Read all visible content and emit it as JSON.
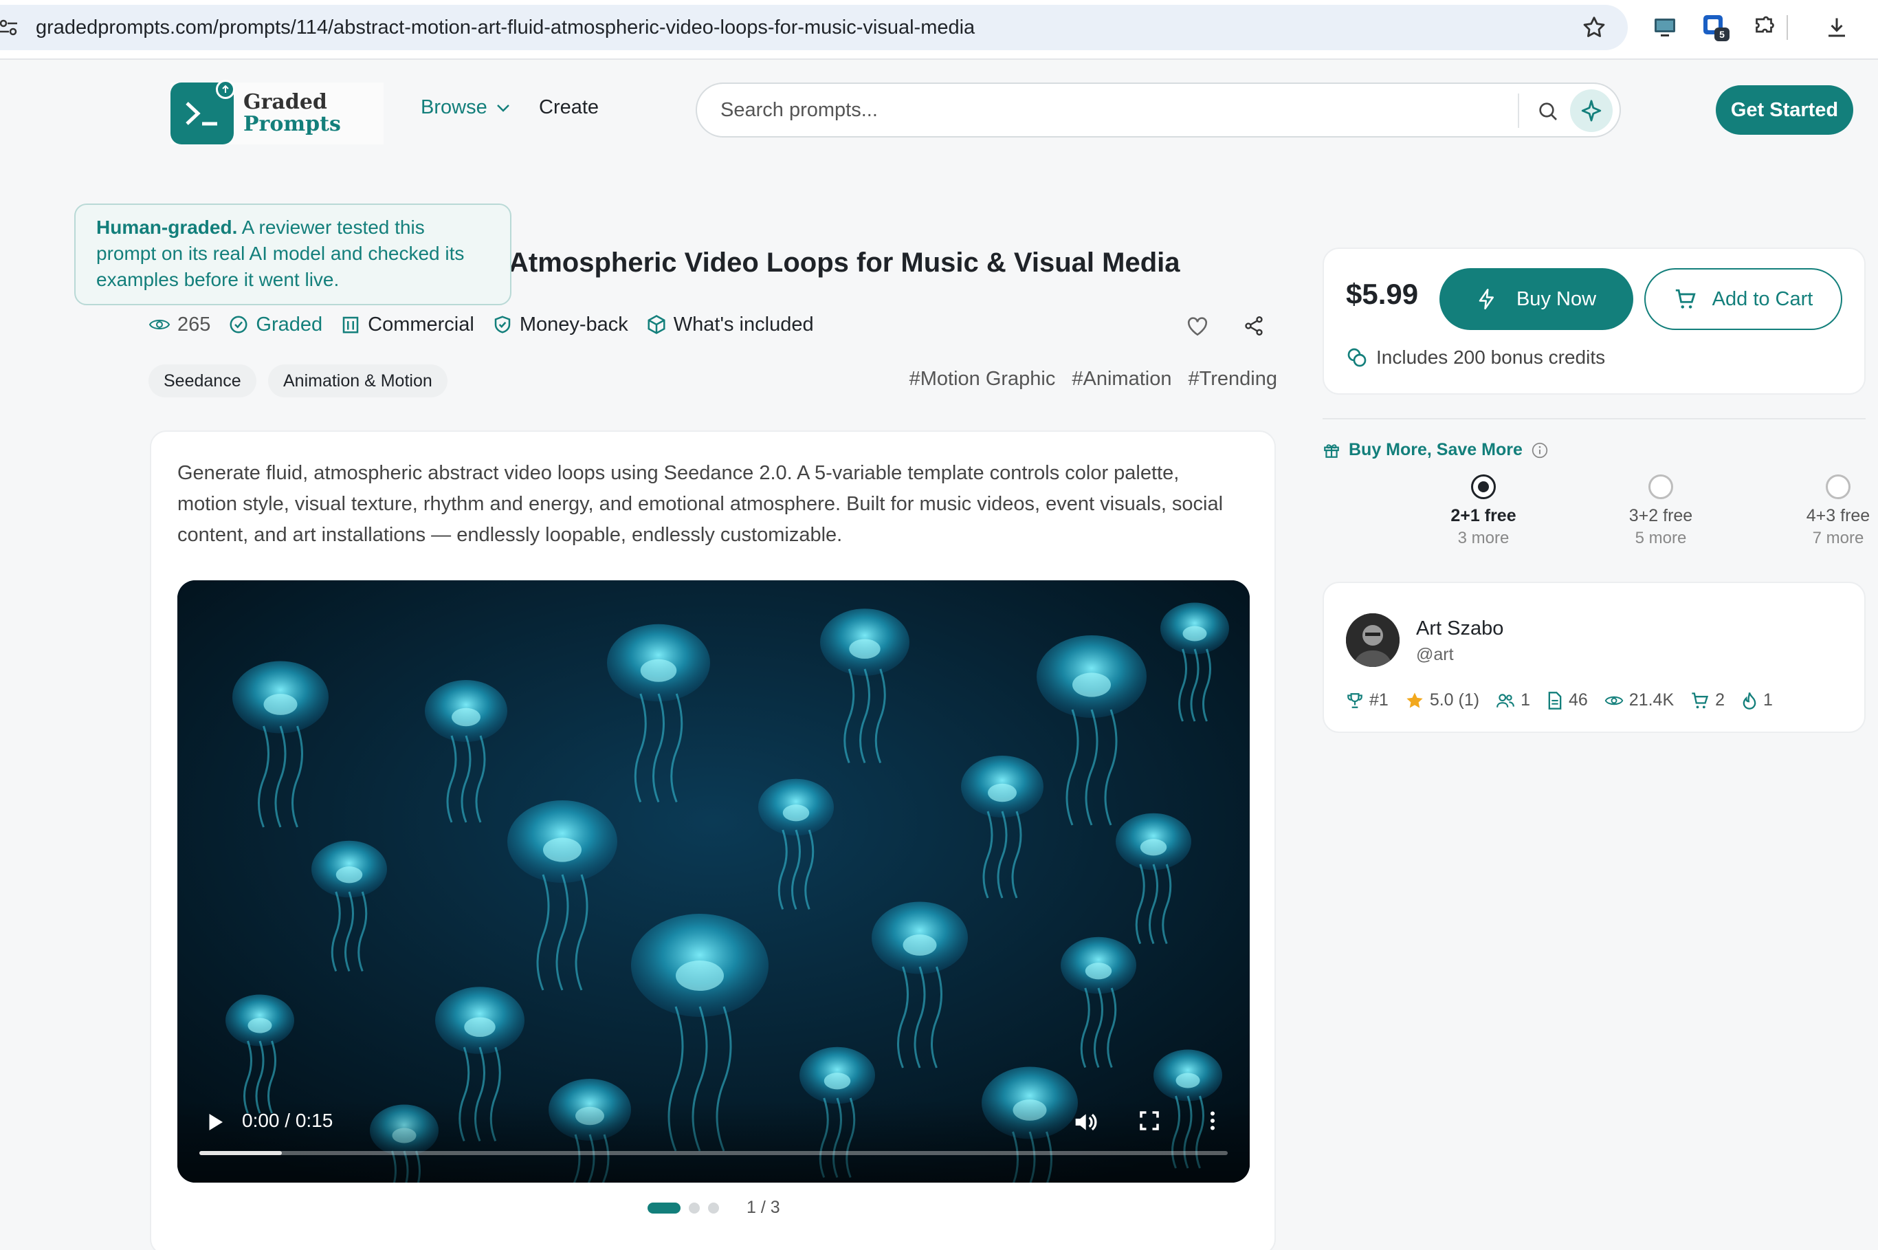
{
  "browser": {
    "url": "gradedprompts.com/prompts/114/abstract-motion-art-fluid-atmospheric-video-loops-for-music-visual-media",
    "extension_badge": "5"
  },
  "header": {
    "logo_line1": "Graded",
    "logo_line2": "Prompts",
    "nav_browse": "Browse",
    "nav_create": "Create",
    "search_placeholder": "Search prompts...",
    "get_started": "Get Started"
  },
  "prompt": {
    "title_visible": "Atmospheric Video Loops for Music & Visual Media",
    "tooltip_bold": "Human-graded.",
    "tooltip_text": " A reviewer tested this prompt on its real AI model and checked its examples before it went live.",
    "views": "265",
    "badge_graded": "Graded",
    "badge_commercial": "Commercial",
    "badge_moneyback": "Money-back",
    "badge_included": "What's included",
    "chips": [
      "Seedance",
      "Animation & Motion"
    ],
    "hashtags": [
      "#Motion Graphic",
      "#Animation",
      "#Trending"
    ],
    "description": "Generate fluid, atmospheric abstract video loops using Seedance 2.0. A 5-variable template controls color palette, motion style, visual texture, rhythm and energy, and emotional atmosphere. Built for music videos, event visuals, social content, and art installations — endlessly loopable, endlessly customizable."
  },
  "video": {
    "time": "0:00 / 0:15",
    "progress": 0.08,
    "pager": "1 / 3"
  },
  "purchase": {
    "price": "$5.99",
    "buy_now": "Buy Now",
    "add_to_cart": "Add to Cart",
    "bonus": "Includes 200 bonus credits",
    "bulk_title": "Buy More, Save More",
    "tiers": [
      {
        "label": "2+1 free",
        "sub": "3 more",
        "selected": true
      },
      {
        "label": "3+2 free",
        "sub": "5 more",
        "selected": false
      },
      {
        "label": "4+3 free",
        "sub": "7 more",
        "selected": false
      }
    ]
  },
  "author": {
    "name": "Art Szabo",
    "handle": "@art",
    "rank": "#1",
    "rating": "5.0 (1)",
    "followers": "1",
    "prompts": "46",
    "views": "21.4K",
    "sales": "2",
    "fire": "1"
  },
  "colors": {
    "brand": "#137f7b",
    "star": "#f2a81d"
  }
}
